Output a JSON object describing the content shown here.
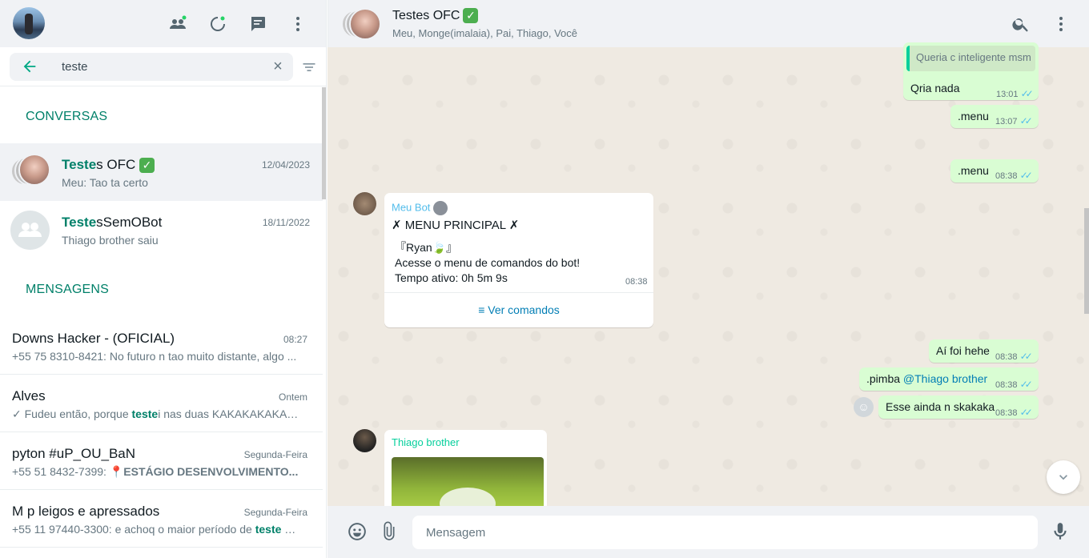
{
  "left": {
    "search": {
      "value": "teste",
      "clear": "×"
    },
    "sections": {
      "conversations": "CONVERSAS",
      "messages": "MENSAGENS"
    },
    "chats": [
      {
        "name_match": "Teste",
        "name_rest": "s OFC",
        "verified": "✓",
        "date": "12/04/2023",
        "last": "Meu: Tao ta certo"
      },
      {
        "name_match": "Teste",
        "name_rest": "sSemOBot",
        "date": "18/11/2022",
        "last": "Thiago brother saiu"
      }
    ],
    "messages": [
      {
        "title": "Downs Hacker - (OFICIAL)",
        "time": "08:27",
        "pre": "+55 75 8310-8421: No futuro n tao muito distante, algo ...",
        "match": "",
        "post": ""
      },
      {
        "title": "Alves",
        "time": "Ontem",
        "pre": "✓ Fudeu então, porque ",
        "match": "teste",
        "post": "i nas duas KAKAKAKAKAKAK"
      },
      {
        "title": "pyton #uP_OU_BaN",
        "time": "Segunda-Feira",
        "pre": "+55 51 8432-7399: 📍",
        "bold": "ESTÁGIO DESENVOLVIMENTO...",
        "match": "",
        "post": ""
      },
      {
        "title": "M p leigos e apressados",
        "time": "Segunda-Feira",
        "pre": "+55 11 97440-3300: e achoq o maior período de ",
        "match": "teste",
        "post": " é ..."
      }
    ]
  },
  "right": {
    "group": {
      "title": "Testes OFC",
      "verified": "✓",
      "members": "Meu, Monge(imalaia), Pai, Thiago, Você"
    },
    "bubbles": {
      "quoted": "Queria c inteligente msm",
      "qria_nada": "Qria nada",
      "qria_time": "13:01",
      "menu1": ".menu",
      "menu1_time": "13:07",
      "menu2": ".menu",
      "menu2_time": "08:38",
      "bot_name": "Meu Bot",
      "bot_title": "✗ MENU PRINCIPAL ✗",
      "bot_user": "『Ryan🍃』",
      "bot_line1": "Acesse o menu de comandos do bot!",
      "bot_line2": "Tempo ativo: 0h 5m 9s",
      "bot_time": "08:38",
      "bot_button": "Ver comandos",
      "ai_foi": "Aí foi hehe",
      "ai_time": "08:38",
      "pimba": ".pimba ",
      "pimba_mention": "@Thiago brother",
      "pimba_time": "08:38",
      "esse": "Esse ainda n skakaka",
      "esse_time": "08:38",
      "thiago_name": "Thiago brother",
      "ticks": "✓✓"
    },
    "compose": {
      "placeholder": "Mensagem"
    }
  },
  "colors": {
    "accent": "#008069",
    "outgoing": "#d9fdd3",
    "ticks": "#53bdeb"
  }
}
